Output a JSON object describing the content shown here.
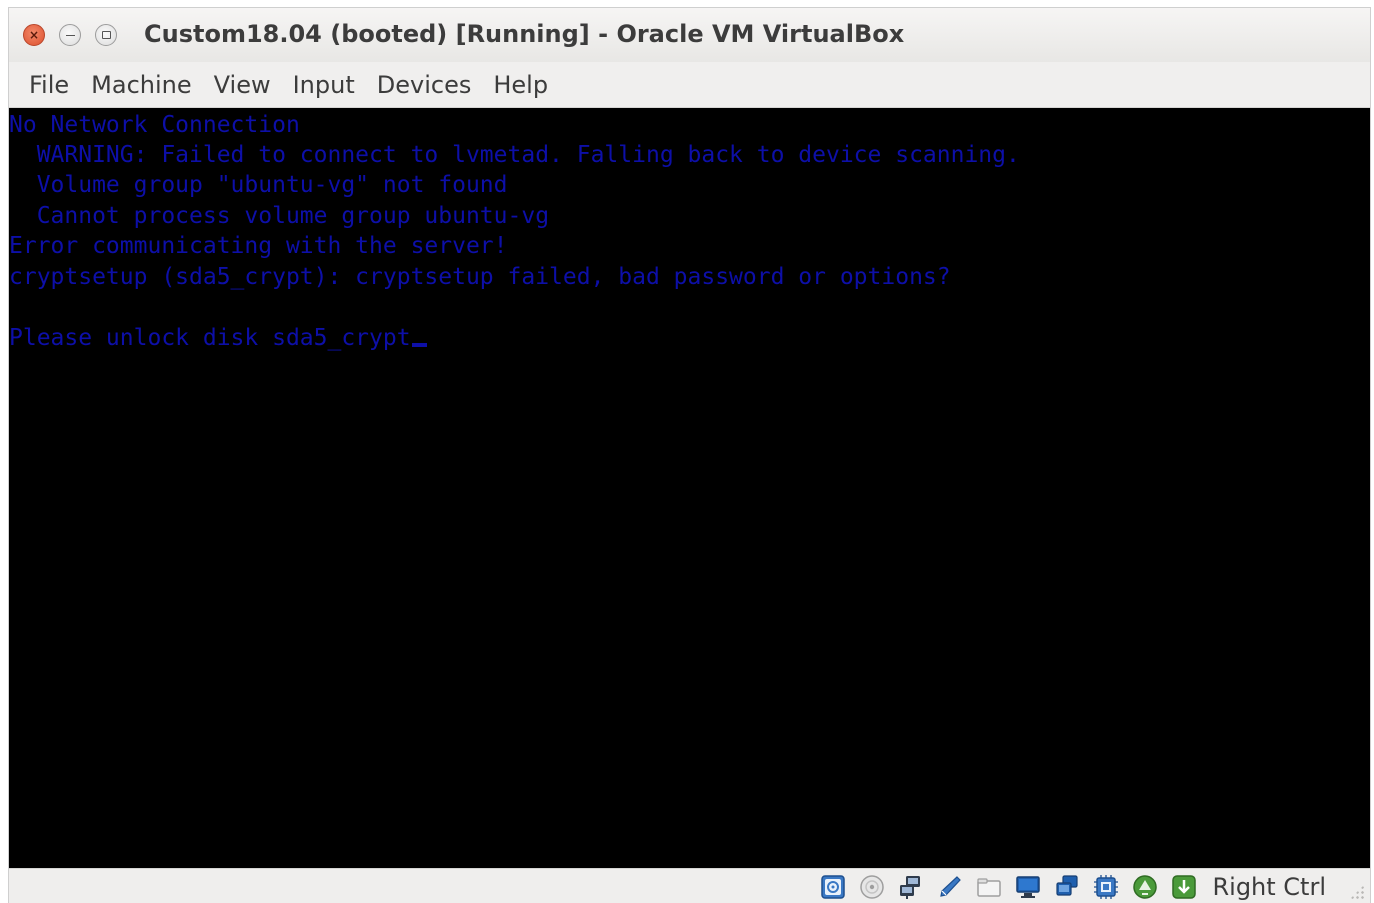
{
  "window": {
    "title": "Custom18.04 (booted) [Running] - Oracle VM VirtualBox",
    "buttons": {
      "close_icon": "close-icon",
      "minimize_icon": "minimize-icon",
      "maximize_icon": "maximize-icon"
    }
  },
  "menu": {
    "items": [
      "File",
      "Machine",
      "View",
      "Input",
      "Devices",
      "Help"
    ]
  },
  "console": {
    "text_color": "#0d0fa8",
    "background": "#000000",
    "lines": [
      "No Network Connection",
      "  WARNING: Failed to connect to lvmetad. Falling back to device scanning.",
      "  Volume group \"ubuntu-vg\" not found",
      "  Cannot process volume group ubuntu-vg",
      "Error communicating with the server!",
      "cryptsetup (sda5_crypt): cryptsetup failed, bad password or options?",
      "",
      "Please unlock disk sda5_crypt"
    ]
  },
  "statusbar": {
    "icons": [
      "hard-disk-icon",
      "optical-drive-icon",
      "network-icon",
      "usb-icon",
      "shared-folders-icon",
      "display-icon",
      "video-capture-icon",
      "cpu-icon",
      "mouse-integration-icon",
      "keyboard-capture-icon"
    ],
    "host_key": "Right Ctrl"
  }
}
